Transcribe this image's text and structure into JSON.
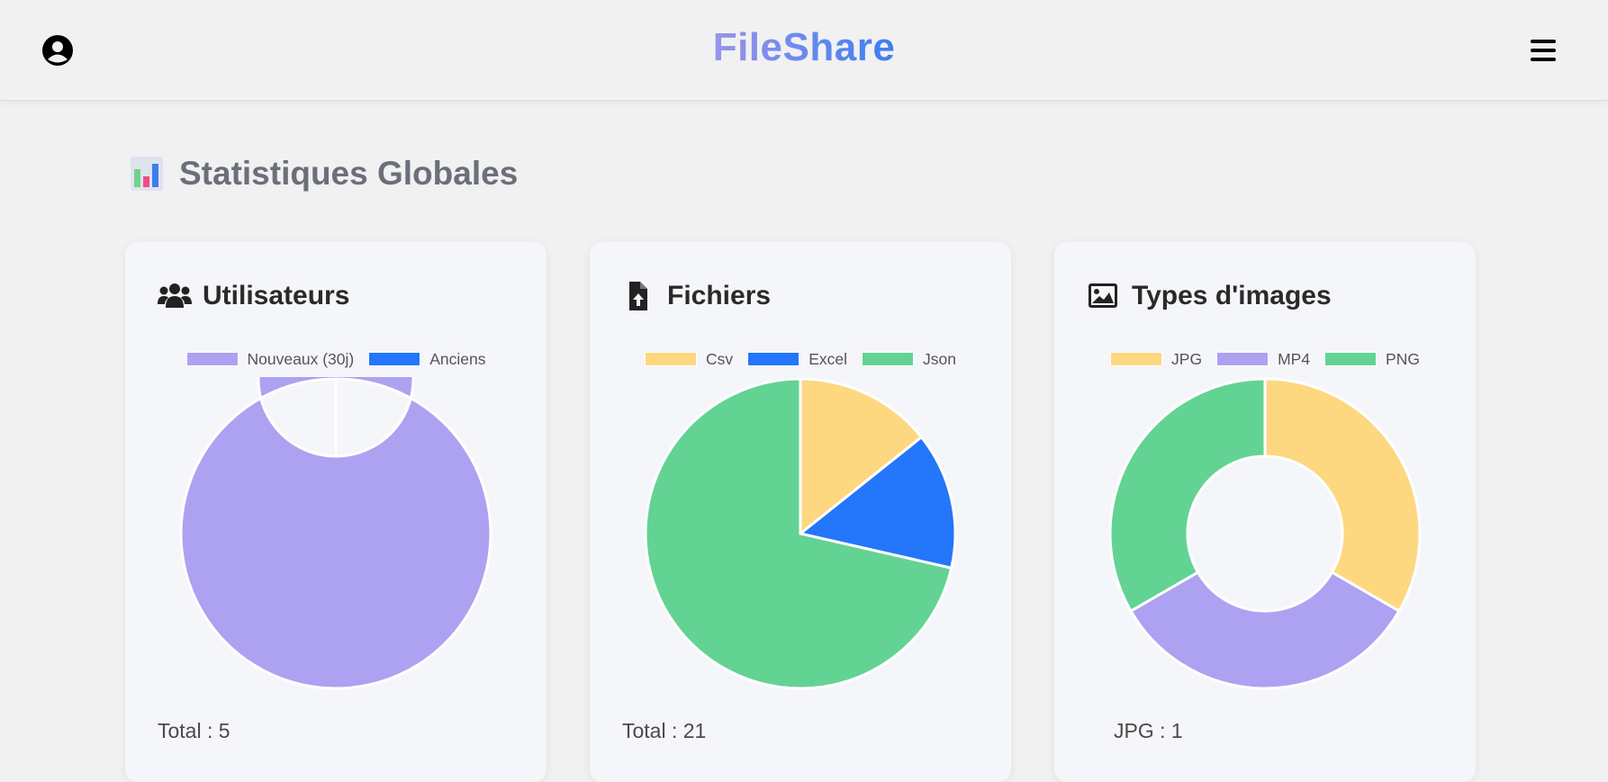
{
  "header": {
    "brand": "FileShare",
    "user_icon": "user-circle-icon",
    "menu_icon": "hamburger-menu-icon"
  },
  "page": {
    "title": "Statistiques Globales",
    "title_icon": "bar-chart-emoji-icon"
  },
  "cards": [
    {
      "title": "Utilisateurs",
      "icon": "users-icon",
      "footer": "Total : 5"
    },
    {
      "title": "Fichiers",
      "icon": "file-upload-icon",
      "footer": "Total : 21"
    },
    {
      "title": "Types d'images",
      "icon": "image-icon",
      "footer": "JPG : 1"
    }
  ],
  "colors": {
    "brand_gradient_start": "#9a94ec",
    "brand_gradient_end": "#3c7ff0",
    "purple": "#ada2f1",
    "blue": "#2476fa",
    "yellow": "#fdd880",
    "green": "#63d394",
    "card_bg": "#f5f6f9"
  },
  "chart_data": [
    {
      "type": "doughnut",
      "legend_position": "top",
      "categories": [
        "Nouveaux (30j)",
        "Anciens"
      ],
      "values": [
        5,
        0
      ],
      "colors": [
        "#ada2f1",
        "#2476fa"
      ]
    },
    {
      "type": "pie",
      "legend_position": "top",
      "categories": [
        "Csv",
        "Excel",
        "Json"
      ],
      "values": [
        3,
        3,
        15
      ],
      "colors": [
        "#fdd880",
        "#2476fa",
        "#63d394"
      ]
    },
    {
      "type": "doughnut",
      "legend_position": "top",
      "categories": [
        "JPG",
        "MP4",
        "PNG"
      ],
      "values": [
        1,
        1,
        1
      ],
      "colors": [
        "#fdd880",
        "#ada2f1",
        "#63d394"
      ]
    }
  ]
}
